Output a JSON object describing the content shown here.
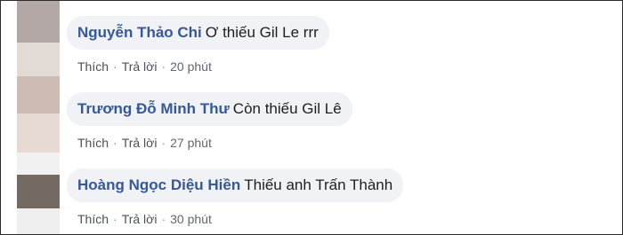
{
  "comments": [
    {
      "author": "Nguyễn Thảo Chi",
      "text": "Ơ thiếu Gil Le rrr",
      "like_label": "Thích",
      "reply_label": "Trả lời",
      "separator": "·",
      "time": "20 phút"
    },
    {
      "author": "Trương Đỗ Minh Thư",
      "text": "Còn thiếu Gil Lê",
      "like_label": "Thích",
      "reply_label": "Trả lời",
      "separator": "·",
      "time": "27 phút"
    },
    {
      "author": "Hoàng Ngọc Diệu Hiền",
      "text": "Thiếu anh Trấn Thành",
      "like_label": "Thích",
      "reply_label": "Trả lời",
      "separator": "·",
      "time": "30 phút"
    }
  ],
  "colors": {
    "author_link": "#365899",
    "bubble_bg": "#f0f2f5",
    "meta_text": "#606770",
    "border": "#2b2b2b"
  }
}
